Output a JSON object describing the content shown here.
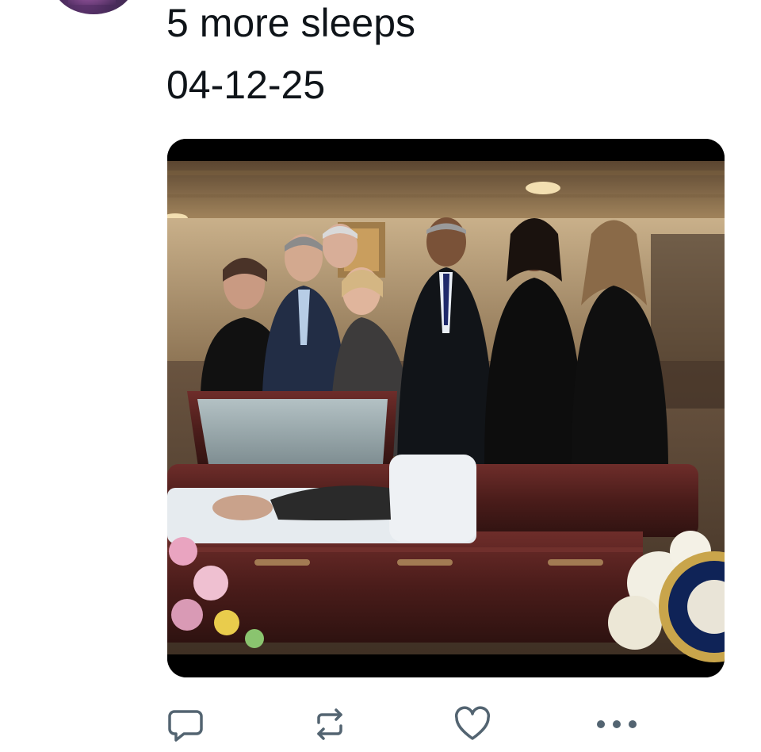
{
  "tweet": {
    "lines": [
      "5 more sleeps",
      "04-12-25"
    ]
  },
  "media": {
    "kind": "photo",
    "subject": "photo-of-group-beside-open-casket"
  },
  "actions": [
    {
      "name": "reply-button",
      "icon": "reply-icon"
    },
    {
      "name": "retweet-button",
      "icon": "retweet-icon"
    },
    {
      "name": "like-button",
      "icon": "heart-icon"
    },
    {
      "name": "more-button",
      "icon": "more-dots-icon"
    }
  ],
  "colors": {
    "text": "#0f1419",
    "icon": "#536471"
  }
}
